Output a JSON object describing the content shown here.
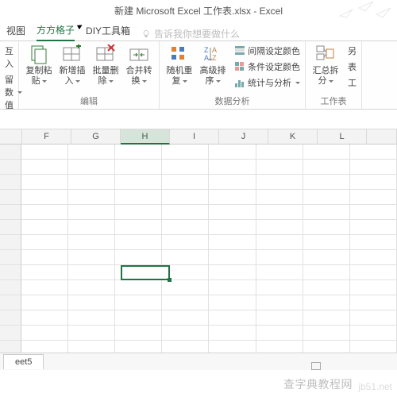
{
  "title": "新建 Microsoft Excel 工作表.xlsx - Excel",
  "tabs": {
    "view": "视图",
    "fangfang": "方方格子",
    "diy": "DIY工具箱",
    "tellme": "告诉我你想要做什么"
  },
  "ribbon": {
    "partialLeft": {
      "top": "互入",
      "bottom": "留数值"
    },
    "edit": {
      "label": "编辑",
      "copy": {
        "l1": "复制粘",
        "l2": "贴"
      },
      "insert": {
        "l1": "新增插",
        "l2": "入"
      },
      "delete": {
        "l1": "批量删",
        "l2": "除"
      },
      "merge": {
        "l1": "合并转",
        "l2": "换"
      }
    },
    "analysis": {
      "label": "数据分析",
      "shuffle": {
        "l1": "随机重",
        "l2": "复"
      },
      "sort": {
        "l1": "高级排",
        "l2": "序"
      },
      "interval": "间隔设定颜色",
      "cond": "条件设定颜色",
      "stats": "统计与分析"
    },
    "worksheet": {
      "label": "工作表",
      "summary": {
        "l1": "汇总拆",
        "l2": "分"
      },
      "r1": "另",
      "r2": "表",
      "r3": "工"
    }
  },
  "columns": [
    "F",
    "G",
    "H",
    "I",
    "J",
    "K",
    "L"
  ],
  "selectedCol": "H",
  "sheetTab": "eet5",
  "watermark": "查字典教程网",
  "watermark2": "jb51.net"
}
